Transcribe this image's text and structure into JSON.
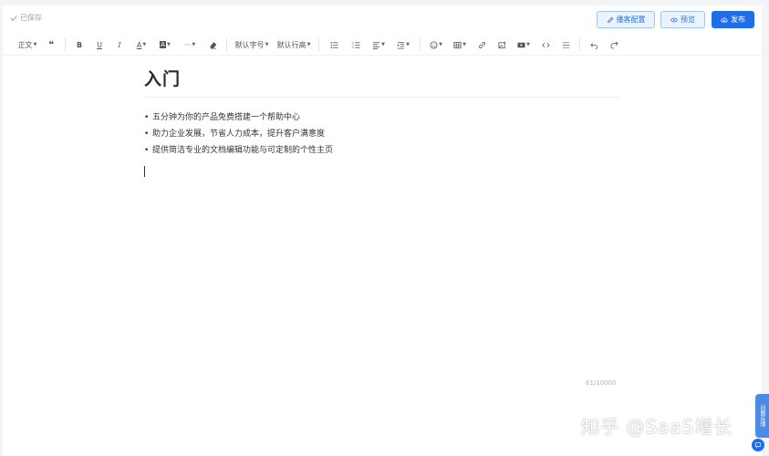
{
  "header": {
    "saved_status": "已保存",
    "buttons": {
      "config": "播客配置",
      "preview": "预览",
      "publish": "发布"
    }
  },
  "toolbar": {
    "paragraph": "正文",
    "font_size": "默认字号",
    "line_height": "默认行高",
    "more": "···"
  },
  "document": {
    "title": "入门",
    "bullets": [
      "五分钟为你的产品免费搭建一个帮助中心",
      "助力企业发展，节省人力成本，提升客户满意度",
      "提供简洁专业的文档编辑功能与可定制的个性主页"
    ],
    "char_count": "61/10000"
  },
  "side": {
    "feedback_tab": "问题反馈"
  },
  "watermark": "知乎 @SaaS增长",
  "colors": {
    "accent": "#1f6ee8",
    "accent_light": "#eaf3ff"
  }
}
